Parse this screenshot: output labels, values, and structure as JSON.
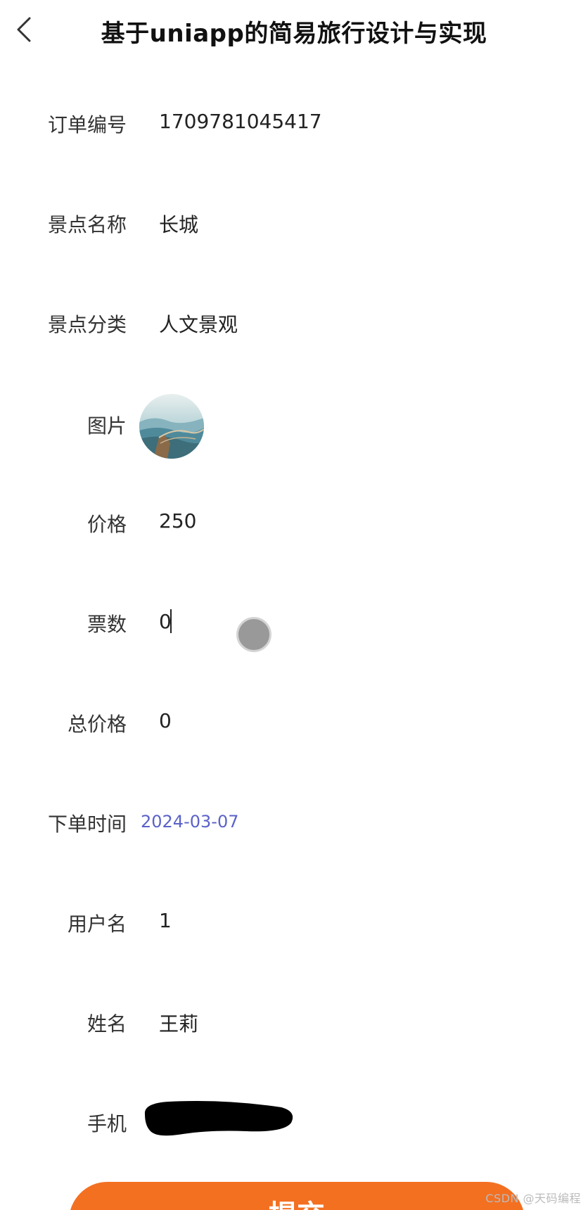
{
  "header": {
    "title": "基于uniapp的简易旅行设计与实现"
  },
  "form": {
    "order_no": {
      "label": "订单编号",
      "value": "1709781045417"
    },
    "spot_name": {
      "label": "景点名称",
      "value": "长城"
    },
    "spot_category": {
      "label": "景点分类",
      "value": "人文景观"
    },
    "picture": {
      "label": "图片"
    },
    "price": {
      "label": "价格",
      "value": "250"
    },
    "tickets": {
      "label": "票数",
      "value": "0"
    },
    "total": {
      "label": "总价格",
      "value": "0"
    },
    "order_time": {
      "label": "下单时间",
      "value": "2024-03-07"
    },
    "username": {
      "label": "用户名",
      "value": "1"
    },
    "name": {
      "label": "姓名",
      "value": "王莉"
    },
    "phone": {
      "label": "手机"
    }
  },
  "submit": {
    "label": "提交"
  },
  "watermark": "CSDN @天码编程",
  "colors": {
    "accent": "#f37021",
    "date_text": "#5b62c8"
  }
}
